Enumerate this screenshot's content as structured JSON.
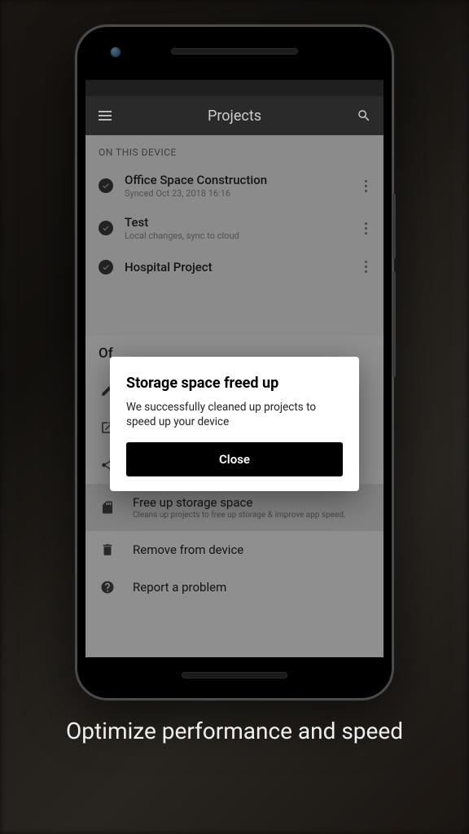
{
  "app_bar": {
    "title": "Projects"
  },
  "section_header": "ON THIS DEVICE",
  "projects": [
    {
      "title": "Office Space Construction",
      "subtitle": "Synced Oct 23, 2018 16:16"
    },
    {
      "title": "Test",
      "subtitle": "Local changes, sync to cloud"
    },
    {
      "title": "Hospital Project",
      "subtitle": ""
    }
  ],
  "sheet": {
    "title_fragment": "Of",
    "items": [
      {
        "label": "Edit",
        "sub": "",
        "icon": "pencil"
      },
      {
        "label": "Open",
        "sub": "",
        "icon": "open"
      },
      {
        "label": "Share",
        "sub": "",
        "icon": "share"
      },
      {
        "label": "Free up storage space",
        "sub": "Cleans up projects to free up storage & improve app speed.",
        "icon": "sd",
        "selected": true
      },
      {
        "label": "Remove from device",
        "sub": "",
        "icon": "trash"
      },
      {
        "label": "Report a problem",
        "sub": "",
        "icon": "help"
      }
    ]
  },
  "dialog": {
    "title": "Storage space freed up",
    "body": "We successfully cleaned up projects to speed up your device",
    "close": "Close"
  },
  "caption": "Optimize performance and speed"
}
